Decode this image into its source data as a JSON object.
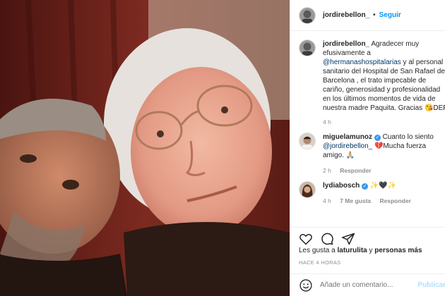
{
  "header": {
    "username": "jordirebellon_",
    "dot": "•",
    "follow_label": "Seguir"
  },
  "caption": {
    "username": "jordirebellon_",
    "lines": [
      "Agradecer muy",
      "efusivamente a",
      "@hermanashospitalarias",
      "y al personal",
      "sanitario del Hospital de San Rafael de",
      "Barcelona , el trato impecable de",
      "cariño, generosidad y profesionalidad",
      "en los últimos momentos de vida de",
      "nuestra madre Paquita. Gracias 😘DEP"
    ],
    "time": "4 h"
  },
  "comments": [
    {
      "username": "miguelamunoz",
      "verified": true,
      "text_1": "Cuanto lo siento",
      "mention": "@jordirebellon_",
      "text_2": "💔Mucha fuerza",
      "text_3": "amigo. 🙏🏼",
      "time": "2 h",
      "reply": "Responder"
    },
    {
      "username": "lydiabosch",
      "verified": true,
      "text_1": "✨🖤✨",
      "time": "4 h",
      "likes": "7 Me gusta",
      "reply": "Responder"
    }
  ],
  "likes": {
    "prefix": "Les gusta a",
    "user": "laturulita",
    "conj": "y",
    "others": "personas más"
  },
  "timestamp": "HACE 4 HORAS",
  "add_comment": {
    "placeholder": "Añade un comentario...",
    "post_label": "Publicar"
  },
  "colors": {
    "accent": "#0095f6",
    "mention": "#00376b",
    "heart": "#e0245e",
    "muted": "#8e8e8e"
  },
  "icons": [
    "heart-icon",
    "comment-icon",
    "share-icon",
    "emoji-icon",
    "verified-icon"
  ]
}
